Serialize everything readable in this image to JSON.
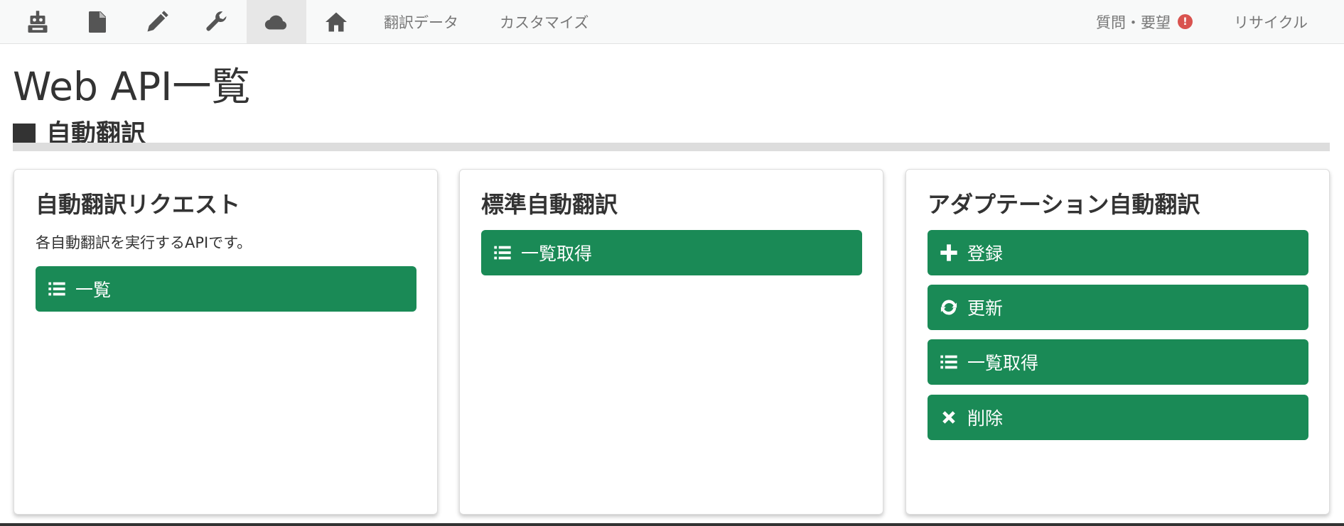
{
  "navbar": {
    "icons": [
      {
        "name": "robot-icon"
      },
      {
        "name": "document-icon"
      },
      {
        "name": "pencil-icon"
      },
      {
        "name": "wrench-icon"
      },
      {
        "name": "cloud-icon",
        "active": true
      },
      {
        "name": "home-icon"
      }
    ],
    "links": {
      "translation_data": "翻訳データ",
      "customize": "カスタマイズ",
      "questions": "質問・要望",
      "questions_badge": "!",
      "recycle": "リサイクル"
    }
  },
  "page": {
    "title": "Web API一覧",
    "section_title": "自動翻訳"
  },
  "cards": {
    "request": {
      "title": "自動翻訳リクエスト",
      "description": "各自動翻訳を実行するAPIです。",
      "list_button": "一覧"
    },
    "standard": {
      "title": "標準自動翻訳",
      "list_get_button": "一覧取得"
    },
    "adaptation": {
      "title": "アダプテーション自動翻訳",
      "register_button": "登録",
      "update_button": "更新",
      "list_get_button": "一覧取得",
      "delete_button": "削除"
    }
  },
  "colors": {
    "button_green": "#1a8a56",
    "alert_red": "#d9534f",
    "navbar_bg": "#f8f9f9"
  }
}
